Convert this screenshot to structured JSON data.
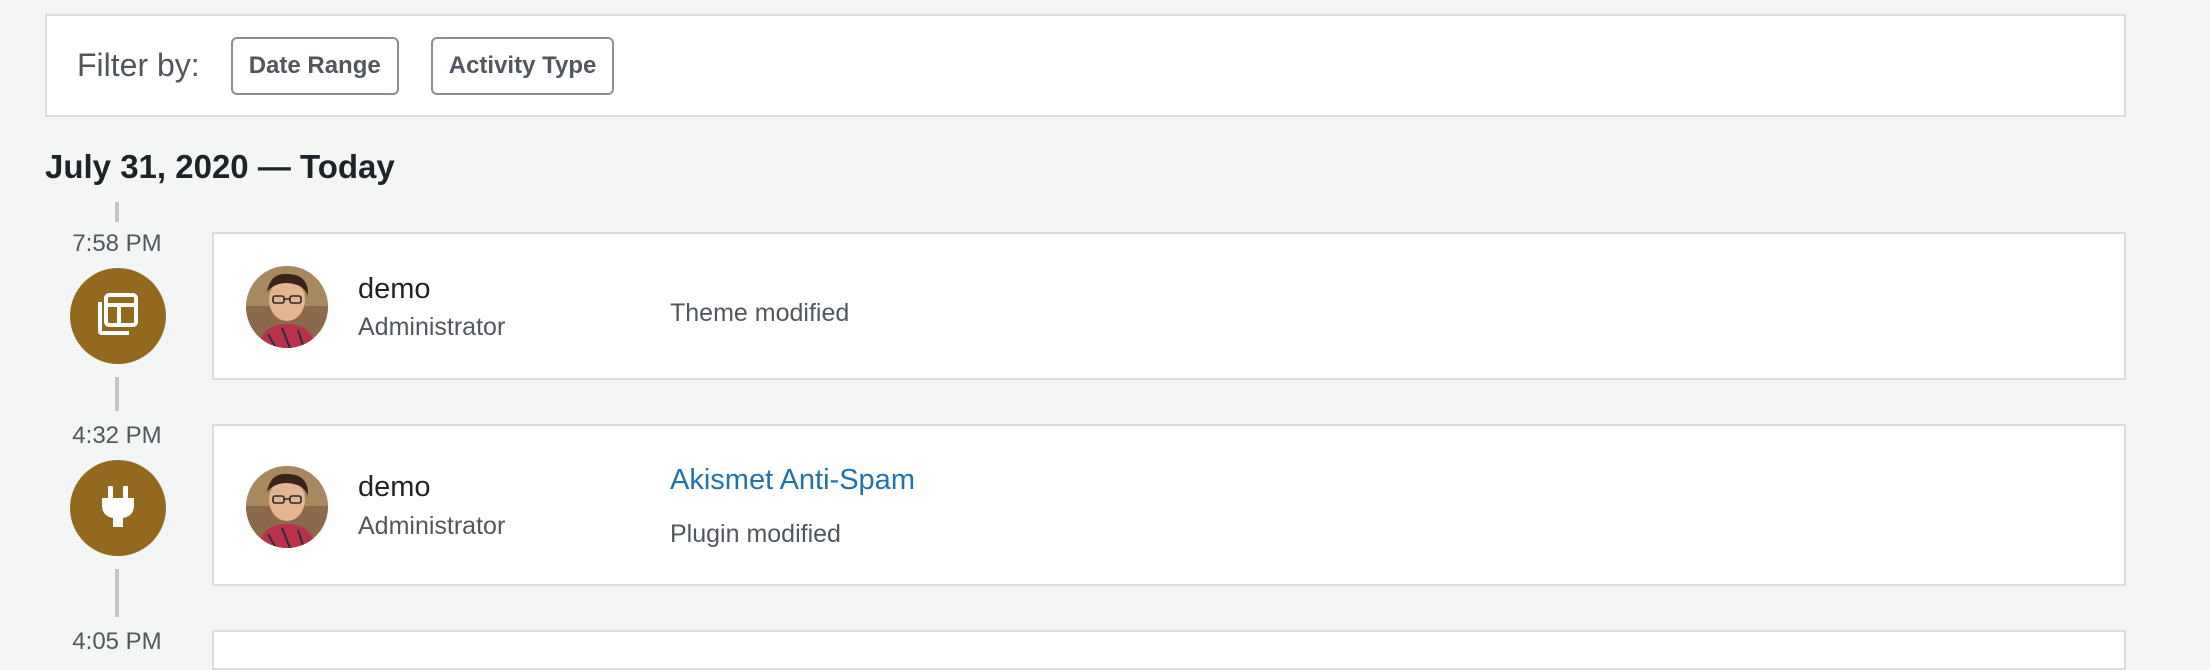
{
  "filter": {
    "label": "Filter by:",
    "buttons": [
      "Date Range",
      "Activity Type"
    ]
  },
  "day": {
    "heading": "July 31, 2020 — Today"
  },
  "colors": {
    "accent": "#93691f",
    "link": "#2271b1"
  },
  "activities": [
    {
      "time": "7:58 PM",
      "icon": "theme-layout-icon",
      "user_name": "demo",
      "user_role": "Administrator",
      "description": "Theme modified"
    },
    {
      "time": "4:32 PM",
      "icon": "plugin-icon",
      "user_name": "demo",
      "user_role": "Administrator",
      "object_link": "Akismet Anti-Spam",
      "description": "Plugin modified"
    }
  ]
}
